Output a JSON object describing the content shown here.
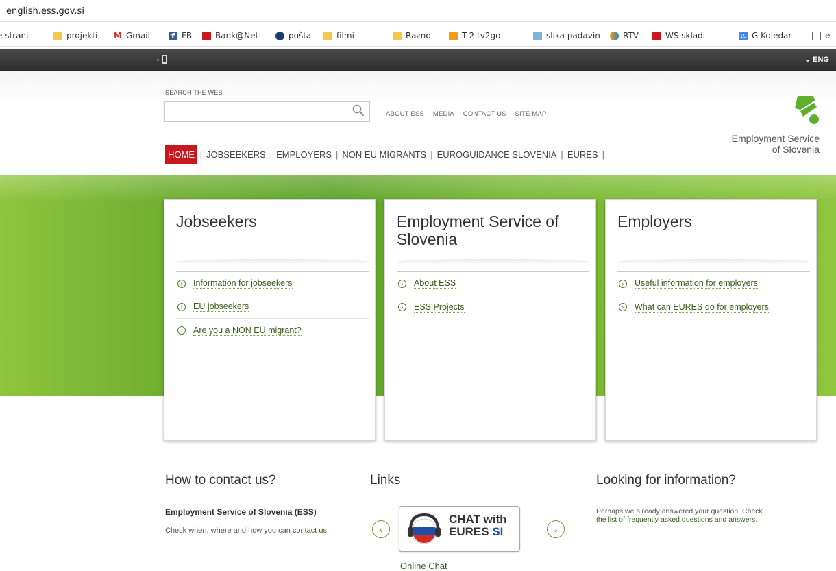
{
  "browser": {
    "address": "english.ess.gov.si",
    "bookmarks": [
      {
        "label": "e strani",
        "icon": "folder-icon"
      },
      {
        "label": "projekti",
        "icon": "folder-icon"
      },
      {
        "label": "Gmail",
        "icon": "gmail-icon"
      },
      {
        "label": "FB",
        "icon": "facebook-icon"
      },
      {
        "label": "Bank@Net",
        "icon": "bank-icon"
      },
      {
        "label": "pošta",
        "icon": "mail-icon"
      },
      {
        "label": "filmi",
        "icon": "folder-icon"
      },
      {
        "label": "Razno",
        "icon": "folder-icon"
      },
      {
        "label": "T-2 tv2go",
        "icon": "tv-icon"
      },
      {
        "label": "slika padavin",
        "icon": "weather-icon"
      },
      {
        "label": "RTV",
        "icon": "rtv-icon"
      },
      {
        "label": "WS skladi",
        "icon": "ws-icon"
      },
      {
        "label": "G Koledar",
        "icon": "calendar-icon"
      },
      {
        "label": "e-",
        "icon": "page-icon"
      }
    ],
    "calendar_day": "19"
  },
  "topbar": {
    "lang": "⌄ ENG"
  },
  "header": {
    "search_label": "SEARCH THE WEB",
    "links": [
      "ABOUT ESS",
      "MEDIA",
      "CONTACT US",
      "SITE MAP"
    ],
    "brand_line1": "Employment Service",
    "brand_line2": "of Slovenia",
    "nav": [
      "HOME",
      "JOBSEEKERS",
      "EMPLOYERS",
      "NON EU MIGRANTS",
      "EUROGUIDANCE SLOVENIA",
      "EURES"
    ]
  },
  "cards": [
    {
      "title": "Jobseekers",
      "links": [
        "Information for jobseekers",
        "EU jobseekers",
        "Are you a NON EU migrant?"
      ]
    },
    {
      "title": "Employment Service of Slovenia",
      "links": [
        "About ESS",
        "ESS Projects"
      ]
    },
    {
      "title": "Employers",
      "links": [
        "Useful information for employers",
        "What can EURES do for employers"
      ]
    }
  ],
  "footer": {
    "contact_title": "How to contact us?",
    "contact_org": "Employment Service of Slovenia (ESS)",
    "contact_text": "Check when, where and how you can ",
    "contact_link": "contact us",
    "contact_end": ".",
    "links_title": "Links",
    "chat_line1": "CHAT with",
    "chat_line2": "EURES",
    "chat_line3": "SI",
    "chat_caption": "Online Chat",
    "info_title": "Looking for information?",
    "info_text": "Perhaps we already answered your question. Check",
    "info_link": "the list of frequently asked questions and answers",
    "info_end": "."
  },
  "colors": {
    "accent_red": "#c8171e",
    "green": "#6fae2f",
    "link_green": "#3a5d1e"
  }
}
